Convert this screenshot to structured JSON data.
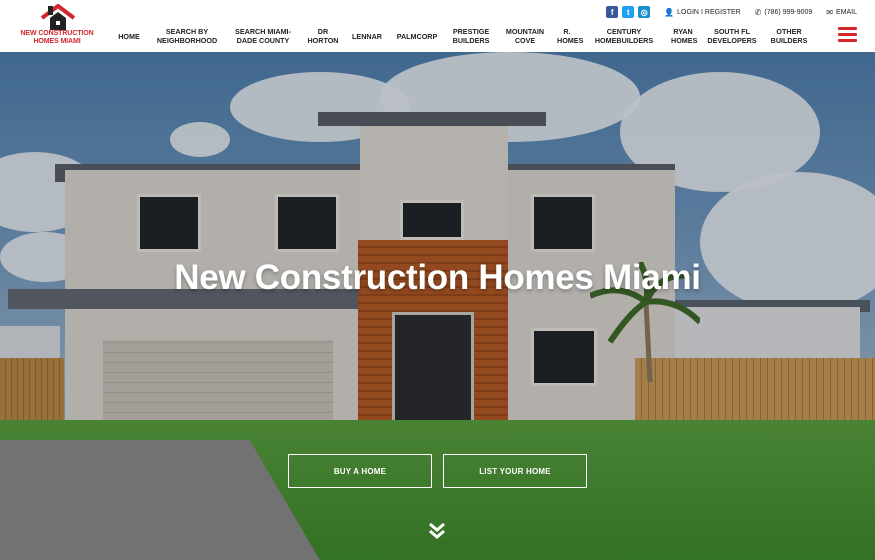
{
  "brand": {
    "logo_text": "NEW CONSTRUCTION HOMES MIAMI",
    "accent_color": "#d3262a"
  },
  "topbar": {
    "social": [
      {
        "name": "facebook-icon",
        "glyph": "f"
      },
      {
        "name": "twitter-icon",
        "glyph": "t"
      },
      {
        "name": "instagram-icon",
        "glyph": "◎"
      }
    ],
    "login_label": "LOGIN",
    "separator": "I",
    "register_label": "REGISTER",
    "phone": "(786) 999-9009",
    "email_label": "EMAIL"
  },
  "nav": {
    "items": [
      {
        "label": "HOME"
      },
      {
        "label": "SEARCH BY NEIGHBORHOOD"
      },
      {
        "label": "SEARCH MIAMI-DADE COUNTY"
      },
      {
        "label": "DR HORTON"
      },
      {
        "label": "LENNAR"
      },
      {
        "label": "PALMCORP"
      },
      {
        "label": "PRESTIGE BUILDERS"
      },
      {
        "label": "MOUNTAIN COVE"
      },
      {
        "label": "R. HOMES"
      },
      {
        "label": "CENTURY HOMEBUILDERS"
      },
      {
        "label": "RYAN HOMES"
      },
      {
        "label": "SOUTH FL DEVELOPERS"
      },
      {
        "label": "OTHER BUILDERS"
      }
    ]
  },
  "hero": {
    "title": "New Construction Homes Miami",
    "buttons": {
      "buy": "BUY A HOME",
      "list": "LIST YOUR HOME"
    }
  }
}
